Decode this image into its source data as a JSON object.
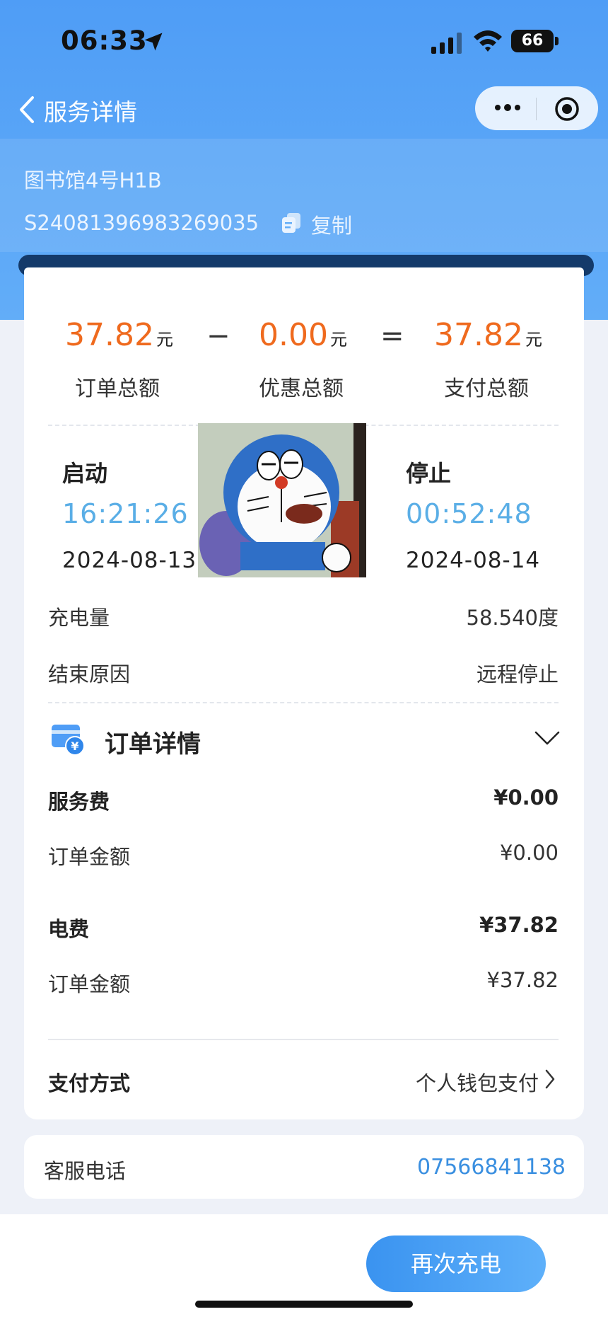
{
  "status_bar": {
    "time": "06:33",
    "battery": "66"
  },
  "nav": {
    "title": "服务详情"
  },
  "order": {
    "station": "图书馆4号H1B",
    "order_no": "S24081396983269035",
    "copy_label": "复制"
  },
  "summary": {
    "total": {
      "value": "37.82",
      "unit": "元",
      "label": "订单总额"
    },
    "minus": "−",
    "discount": {
      "value": "0.00",
      "unit": "元",
      "label": "优惠总额"
    },
    "equals": "=",
    "paid": {
      "value": "37.82",
      "unit": "元",
      "label": "支付总额"
    }
  },
  "session": {
    "start": {
      "label": "启动",
      "time": "16:21:26",
      "date": "2024-08-13"
    },
    "stop": {
      "label": "停止",
      "time": "00:52:48",
      "date": "2024-08-14"
    }
  },
  "rows": {
    "energy": {
      "label": "充电量",
      "value": "58.540度"
    },
    "end_reason": {
      "label": "结束原因",
      "value": "远程停止"
    }
  },
  "detail": {
    "title": "订单详情",
    "service_fee": {
      "label": "服务费",
      "value": "¥0.00"
    },
    "service_order": {
      "label": "订单金额",
      "value": "¥0.00"
    },
    "electricity_fee": {
      "label": "电费",
      "value": "¥37.82"
    },
    "electricity_order": {
      "label": "订单金额",
      "value": "¥37.82"
    },
    "payment": {
      "label": "支付方式",
      "value": "个人钱包支付"
    }
  },
  "support": {
    "label": "客服电话",
    "phone": "07566841138"
  },
  "actions": {
    "recharge": "再次充电"
  },
  "colors": {
    "accent_orange": "#ef6a1e",
    "accent_blue": "#3a8fe0",
    "header_blue": "#4f9df6"
  }
}
